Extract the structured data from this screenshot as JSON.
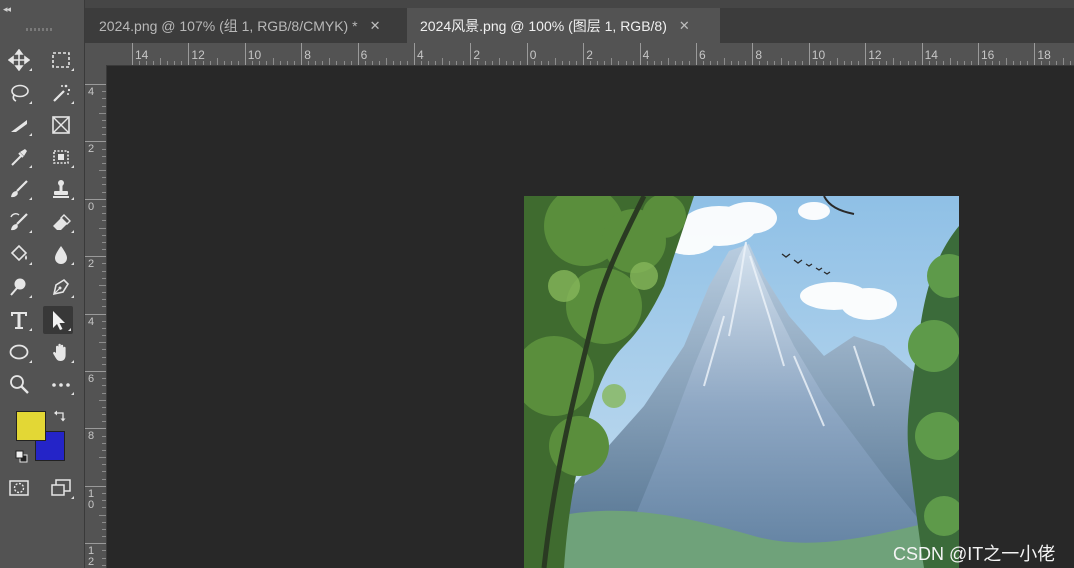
{
  "tools_panel": {
    "collapse_label": "◂◂",
    "foreground_color": "#e3d735",
    "background_color": "#2424c8",
    "tools": [
      {
        "name": "move-tool",
        "icon": "move-icon"
      },
      {
        "name": "rectangular-marquee-tool",
        "icon": "marquee-icon"
      },
      {
        "name": "lasso-tool",
        "icon": "lasso-icon"
      },
      {
        "name": "magic-wand-tool",
        "icon": "magic-wand-icon"
      },
      {
        "name": "slice-tool",
        "icon": "slice-icon"
      },
      {
        "name": "frame-tool",
        "icon": "frame-icon"
      },
      {
        "name": "eyedropper-tool",
        "icon": "eyedropper-icon"
      },
      {
        "name": "object-selection-tool",
        "icon": "object-selection-icon"
      },
      {
        "name": "brush-tool",
        "icon": "brush-icon"
      },
      {
        "name": "clone-stamp-tool",
        "icon": "stamp-icon"
      },
      {
        "name": "history-brush-tool",
        "icon": "history-brush-icon"
      },
      {
        "name": "eraser-tool",
        "icon": "eraser-icon"
      },
      {
        "name": "paint-bucket-tool",
        "icon": "paint-bucket-icon"
      },
      {
        "name": "blur-tool",
        "icon": "drop-icon"
      },
      {
        "name": "dodge-tool",
        "icon": "dodge-icon"
      },
      {
        "name": "pen-tool",
        "icon": "pen-icon"
      },
      {
        "name": "type-tool",
        "icon": "type-icon"
      },
      {
        "name": "path-selection-tool",
        "icon": "arrow-icon"
      },
      {
        "name": "ellipse-tool",
        "icon": "ellipse-icon"
      },
      {
        "name": "hand-tool",
        "icon": "hand-icon"
      },
      {
        "name": "zoom-tool",
        "icon": "zoom-icon"
      },
      {
        "name": "edit-toolbar",
        "icon": "more-icon"
      },
      {
        "name": "quick-mask-mode",
        "icon": "quick-mask-icon"
      },
      {
        "name": "screen-mode",
        "icon": "screen-mode-icon"
      }
    ]
  },
  "tabs": [
    {
      "label": "2024.png @ 107% (组 1, RGB/8/CMYK) *",
      "close": "✕",
      "active": false
    },
    {
      "label": "2024风景.png @ 100% (图层 1, RGB/8)",
      "close": "✕",
      "active": true
    }
  ],
  "ruler_h_labels": [
    "14",
    "12",
    "10",
    "8",
    "6",
    "4",
    "2",
    "0",
    "2",
    "4",
    "6",
    "8",
    "10",
    "12",
    "14",
    "16",
    "18"
  ],
  "ruler_v_labels": [
    "4",
    "2",
    "0",
    "2",
    "4",
    "6",
    "8",
    "10",
    "12"
  ],
  "watermark": "CSDN @IT之一小佬"
}
